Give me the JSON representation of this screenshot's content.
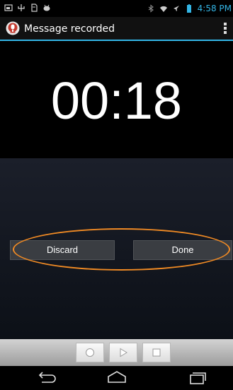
{
  "status_bar": {
    "time": "4:58 PM",
    "icons": [
      "screenshot-icon",
      "usb-icon",
      "sd-card-icon",
      "android-debug-icon",
      "bluetooth-icon",
      "wifi-icon",
      "airplane-mode-icon",
      "battery-icon"
    ]
  },
  "action_bar": {
    "title": "Message recorded",
    "app_icon": "recorder-icon",
    "overflow_icon": "overflow-menu-icon"
  },
  "timer": {
    "elapsed": "00:18"
  },
  "buttons": {
    "discard": "Discard",
    "done": "Done"
  },
  "highlight_color": "#f08a24",
  "accent_color": "#33b5e5",
  "controls": [
    "record-icon",
    "play-icon",
    "stop-icon"
  ],
  "nav": [
    "back-icon",
    "home-icon",
    "recent-apps-icon"
  ]
}
